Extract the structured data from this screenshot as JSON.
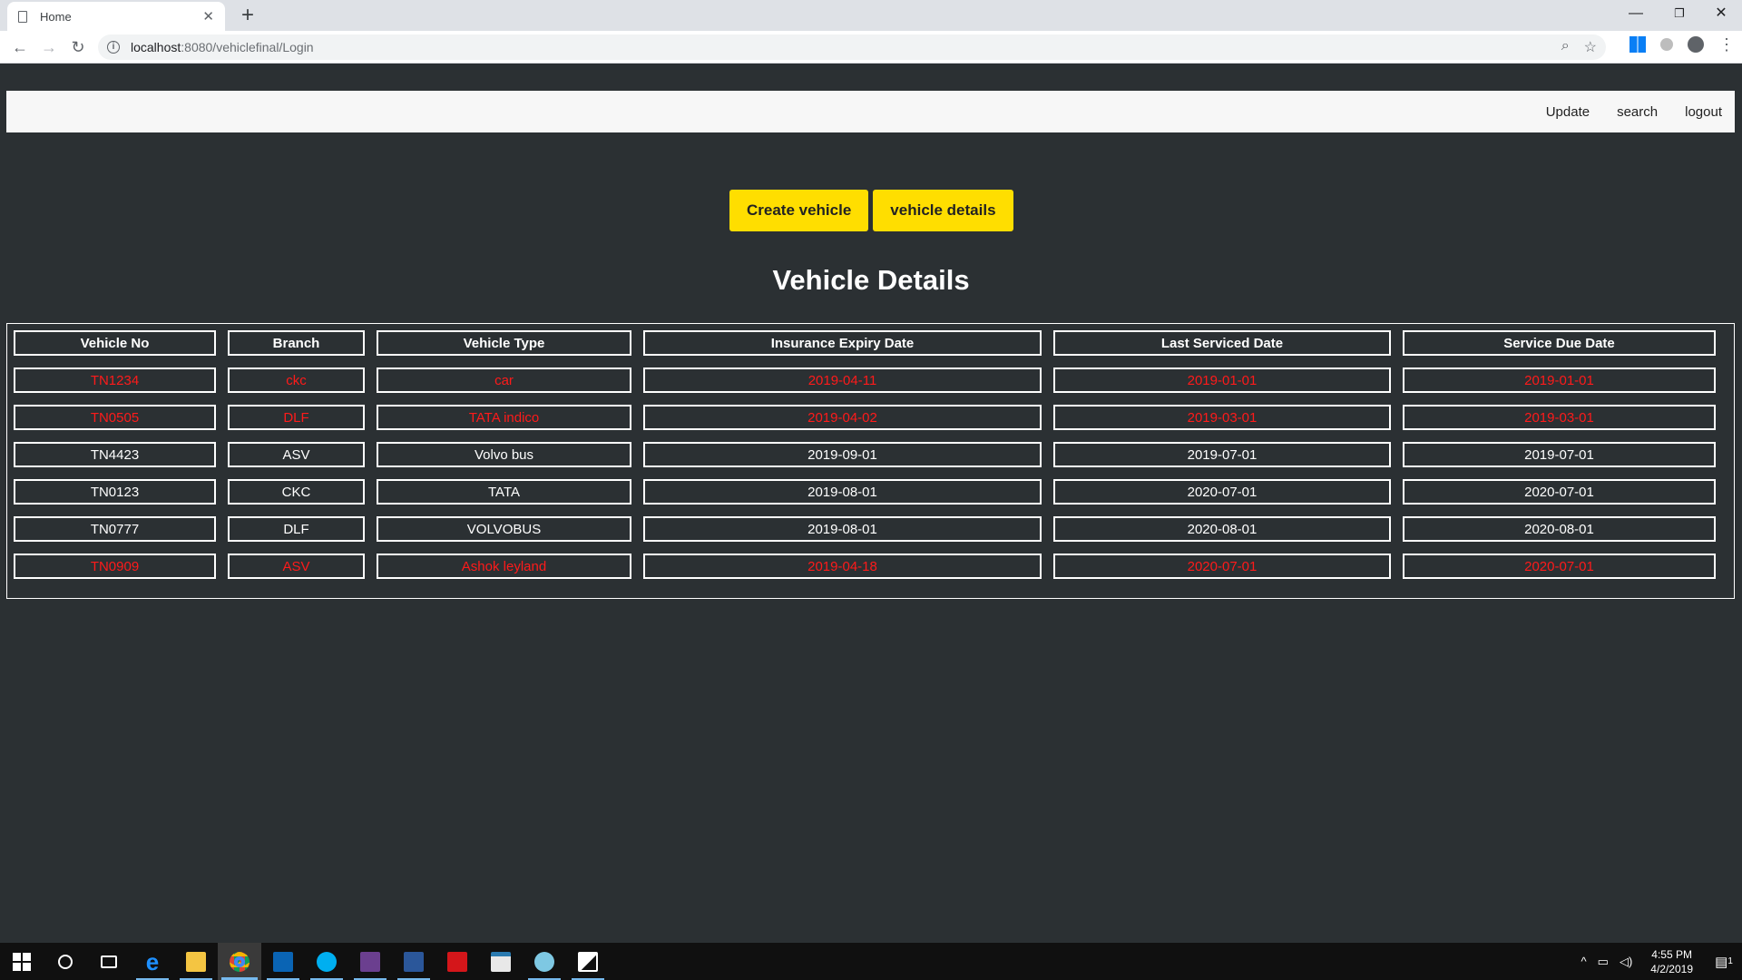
{
  "browser": {
    "tab_title": "Home",
    "tab_close": "✕",
    "new_tab": "+",
    "url_host": "localhost",
    "url_path": ":8080/vehiclefinal/Login",
    "window_controls": {
      "minimize": "—",
      "maximize": "❐",
      "close": "✕"
    }
  },
  "navbar": {
    "links": [
      "Update",
      "search",
      "logout"
    ]
  },
  "actions": {
    "create_label": "Create vehicle",
    "details_label": "vehicle details"
  },
  "heading": "Vehicle Details",
  "table": {
    "headers": [
      "Vehicle No",
      "Branch",
      "Vehicle Type",
      "Insurance Expiry Date",
      "Last Serviced Date",
      "Service Due Date"
    ],
    "rows": [
      {
        "status": "expired",
        "cells": [
          "TN1234",
          "ckc",
          "car",
          "2019-04-11",
          "2019-01-01",
          "2019-01-01"
        ]
      },
      {
        "status": "expired",
        "cells": [
          "TN0505",
          "DLF",
          "TATA indico",
          "2019-04-02",
          "2019-03-01",
          "2019-03-01"
        ]
      },
      {
        "status": "ok",
        "cells": [
          "TN4423",
          "ASV",
          "Volvo bus",
          "2019-09-01",
          "2019-07-01",
          "2019-07-01"
        ]
      },
      {
        "status": "ok",
        "cells": [
          "TN0123",
          "CKC",
          "TATA",
          "2019-08-01",
          "2020-07-01",
          "2020-07-01"
        ]
      },
      {
        "status": "ok",
        "cells": [
          "TN0777",
          "DLF",
          "VOLVOBUS",
          "2019-08-01",
          "2020-08-01",
          "2020-08-01"
        ]
      },
      {
        "status": "expired",
        "cells": [
          "TN0909",
          "ASV",
          "Ashok leyland",
          "2019-04-18",
          "2020-07-01",
          "2020-07-01"
        ]
      }
    ],
    "colors": {
      "normal": "#ffffff",
      "expired": "#ff1a1a"
    }
  },
  "taskbar": {
    "time": "4:55 PM",
    "date": "4/2/2019",
    "notification_count": "1"
  },
  "colors": {
    "page_bg": "#2b3033",
    "button_bg": "#ffde00",
    "navbar_bg": "#f7f7f7"
  }
}
